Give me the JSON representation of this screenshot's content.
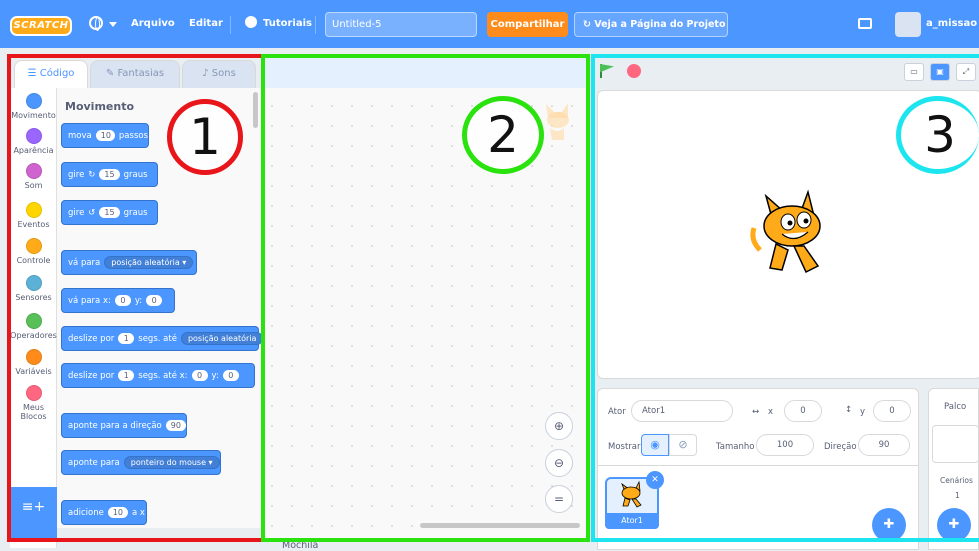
{
  "menubar": {
    "logo": "SCRATCH",
    "file": "Arquivo",
    "edit": "Editar",
    "tutorials": "Tutoriais",
    "project_title": "Untitled-5",
    "share": "Compartilhar",
    "see_project": "Veja a Página do Projeto",
    "username": "a_missao",
    "brand_color": "#4c97ff",
    "share_color": "#ff8c1a"
  },
  "tabs": {
    "code": "Código",
    "costumes": "Fantasias",
    "sounds": "Sons"
  },
  "categories": [
    {
      "label": "Movimento",
      "color": "#4c97ff"
    },
    {
      "label": "Aparência",
      "color": "#9966ff"
    },
    {
      "label": "Som",
      "color": "#cf63cf"
    },
    {
      "label": "Eventos",
      "color": "#ffd500"
    },
    {
      "label": "Controle",
      "color": "#ffab19"
    },
    {
      "label": "Sensores",
      "color": "#5cb1d6"
    },
    {
      "label": "Operadores",
      "color": "#59c059"
    },
    {
      "label": "Variáveis",
      "color": "#ff8c1a"
    },
    {
      "label": "Meus Blocos",
      "color": "#ff6680"
    }
  ],
  "palette": {
    "heading": "Movimento",
    "b1": {
      "a": "mova",
      "v": "10",
      "b": "passos"
    },
    "b2": {
      "a": "gire",
      "v": "15",
      "b": "graus"
    },
    "b3": {
      "a": "gire",
      "v": "15",
      "b": "graus"
    },
    "b4": {
      "a": "vá para",
      "d": "posição aleatória"
    },
    "b5": {
      "a": "vá para x:",
      "v": "0",
      "b": "y:",
      "v2": "0"
    },
    "b6": {
      "a": "deslize por",
      "v": "1",
      "b": "segs. até",
      "d": "posição aleatória"
    },
    "b7": {
      "a": "deslize por",
      "v": "1",
      "b": "segs. até x:",
      "v2": "0",
      "c": "y:",
      "v3": "0"
    },
    "b8": {
      "a": "aponte para a direção",
      "v": "90"
    },
    "b9": {
      "a": "aponte para",
      "d": "ponteiro do mouse"
    },
    "b10": {
      "a": "adicione",
      "v": "10",
      "b": "a x"
    }
  },
  "code": {
    "backpack": "Mochila"
  },
  "sprite_info": {
    "sprite_label": "Ator",
    "sprite_name": "Ator1",
    "x_label": "x",
    "x": "0",
    "y_label": "y",
    "y": "0",
    "show_label": "Mostrar",
    "size_label": "Tamanho",
    "size": "100",
    "direction_label": "Direção",
    "direction": "90",
    "thumb_label": "Ator1"
  },
  "stage_panel": {
    "title": "Palco",
    "backdrops_label": "Cenários",
    "backdrops_count": "1"
  },
  "annotations": [
    {
      "label": "1",
      "color": "#e8161a"
    },
    {
      "label": "2",
      "color": "#2ae20e"
    },
    {
      "label": "3",
      "color": "#1de5f0"
    }
  ]
}
